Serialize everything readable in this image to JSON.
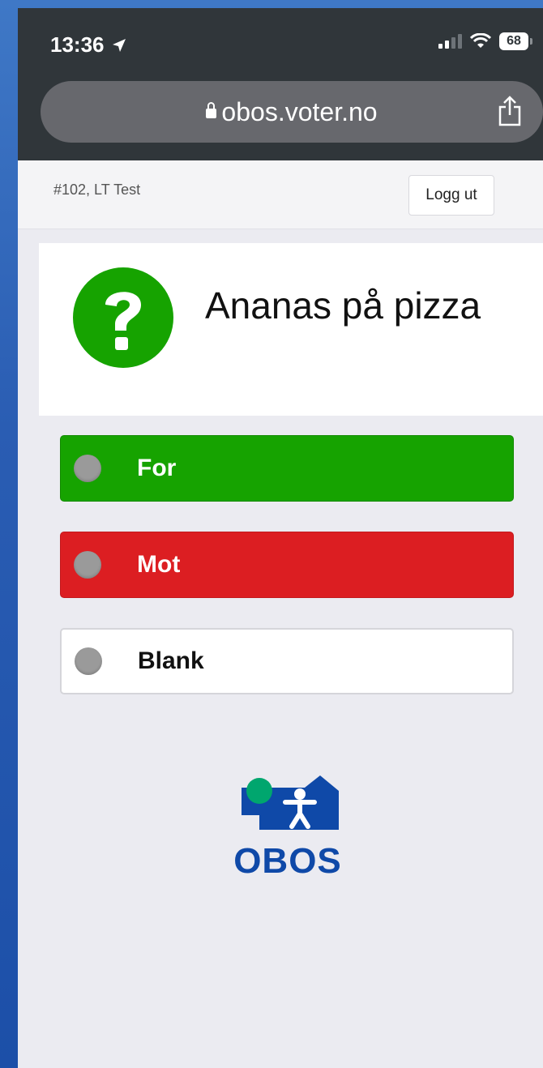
{
  "status_bar": {
    "time": "13:36",
    "battery": "68",
    "location_icon": "location-arrow-icon",
    "wifi_icon": "wifi-icon",
    "signal_icon": "cellular-signal-icon"
  },
  "browser": {
    "url": "obos.voter.no",
    "lock_icon": "lock-icon",
    "share_icon": "share-icon"
  },
  "header": {
    "meeting": "#102, LT Test",
    "logout_label": "Logg ut"
  },
  "question": {
    "icon": "question-mark-icon",
    "icon_color": "#16a300",
    "title": "Ananas på pizza"
  },
  "options": [
    {
      "label": "For",
      "color": "#16a300"
    },
    {
      "label": "Mot",
      "color": "#dc1e22"
    },
    {
      "label": "Blank",
      "color": "#ffffff"
    }
  ],
  "footer": {
    "logo_text": "OBOS",
    "brand_color": "#0f49a8",
    "accent_color": "#00a66e"
  }
}
